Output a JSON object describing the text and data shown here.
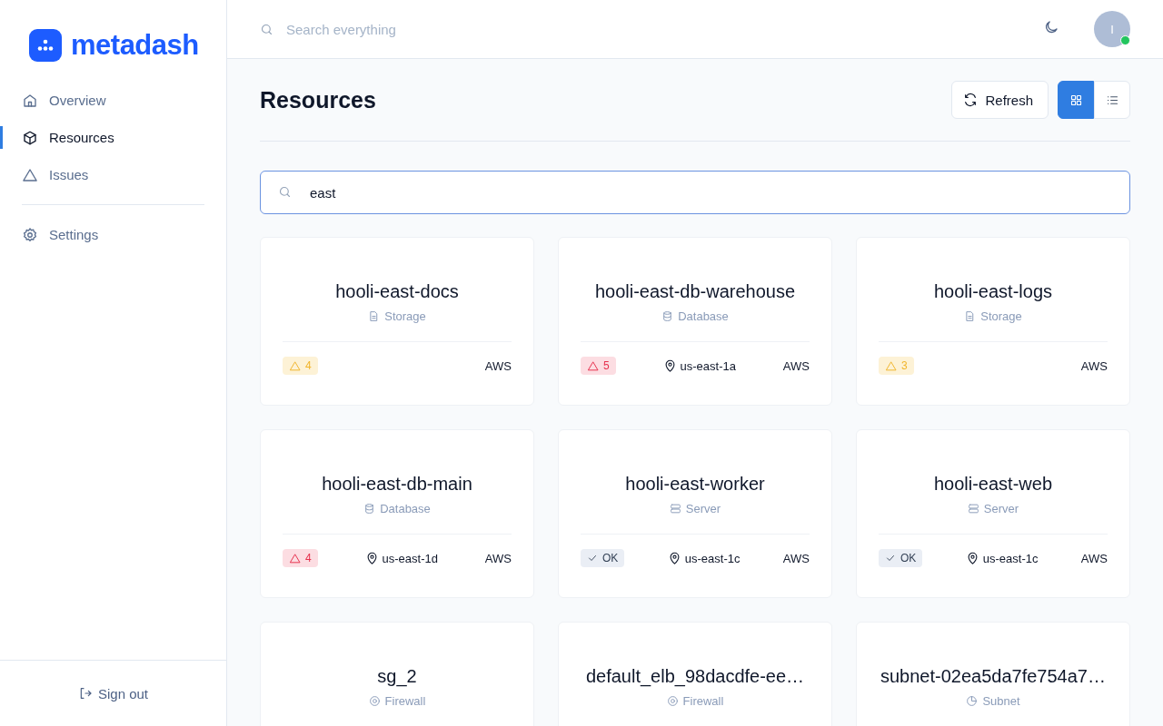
{
  "brand": {
    "name": "metadash"
  },
  "nav": [
    {
      "label": "Overview",
      "kind": "home",
      "selected": false
    },
    {
      "label": "Resources",
      "kind": "cube",
      "selected": true
    },
    {
      "label": "Issues",
      "kind": "triangle",
      "selected": false
    }
  ],
  "nav_bottom": [
    {
      "label": "Settings",
      "kind": "gear",
      "selected": false
    }
  ],
  "sign_out": {
    "label": "Sign out"
  },
  "topbar": {
    "search": {
      "placeholder": "Search everything"
    },
    "avatar": {
      "initial": "I",
      "online": true
    }
  },
  "page": {
    "title": "Resources",
    "refresh": "Refresh",
    "views": [
      {
        "kind": "grid",
        "selected": true
      },
      {
        "kind": "list",
        "selected": false
      }
    ]
  },
  "filter": {
    "value": "east"
  },
  "resources": [
    {
      "name": "hooli-east-docs",
      "kind": "storage",
      "type": "Storage",
      "issues": {
        "kind": "warning",
        "label": "4"
      },
      "provider": "AWS"
    },
    {
      "name": "hooli-east-db-warehouse",
      "kind": "database",
      "type": "Database",
      "issues": {
        "kind": "error",
        "label": "5"
      },
      "region": "us-east-1a",
      "provider": "AWS"
    },
    {
      "name": "hooli-east-logs",
      "kind": "storage",
      "type": "Storage",
      "issues": {
        "kind": "warning",
        "label": "3"
      },
      "provider": "AWS"
    },
    {
      "name": "hooli-east-db-main",
      "kind": "database",
      "type": "Database",
      "issues": {
        "kind": "error",
        "label": "4"
      },
      "region": "us-east-1d",
      "provider": "AWS"
    },
    {
      "name": "hooli-east-worker",
      "kind": "server",
      "type": "Server",
      "issues": {
        "kind": "ok",
        "label": "OK"
      },
      "region": "us-east-1c",
      "provider": "AWS"
    },
    {
      "name": "hooli-east-web",
      "kind": "server",
      "type": "Server",
      "issues": {
        "kind": "ok",
        "label": "OK"
      },
      "region": "us-east-1c",
      "provider": "AWS"
    },
    {
      "name": "sg_2",
      "kind": "firewall",
      "type": "Firewall"
    },
    {
      "name": "default_elb_98dacdfe-ee…",
      "kind": "firewall",
      "type": "Firewall"
    },
    {
      "name": "subnet-02ea5da7fe754a7…",
      "kind": "subnet",
      "type": "Subnet"
    }
  ]
}
